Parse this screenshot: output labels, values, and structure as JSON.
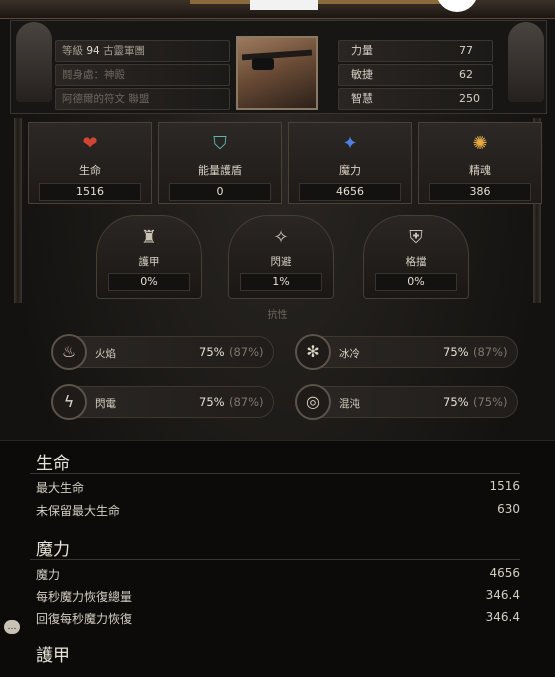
{
  "header": {
    "level_label": "等級",
    "level_value": "94",
    "class_name": "古靈軍團",
    "row2": "鬪身處：神殿",
    "row3": "阿德爾的符文 聯盟"
  },
  "attributes": [
    {
      "label": "力量",
      "value": "77"
    },
    {
      "label": "敏捷",
      "value": "62"
    },
    {
      "label": "智慧",
      "value": "250"
    }
  ],
  "main_stats": [
    {
      "label": "生命",
      "value": "1516",
      "icon": "heart-icon",
      "color": "#c0392b"
    },
    {
      "label": "能量護盾",
      "value": "0",
      "icon": "shield-icon",
      "color": "#4fa0a0"
    },
    {
      "label": "魔力",
      "value": "4656",
      "icon": "mana-icon",
      "color": "#3a6bd6"
    },
    {
      "label": "精魂",
      "value": "386",
      "icon": "spirit-icon",
      "color": "#e0a040"
    }
  ],
  "defenses": [
    {
      "label": "護甲",
      "value": "0%",
      "icon": "armour-icon"
    },
    {
      "label": "閃避",
      "value": "1%",
      "icon": "evasion-icon"
    },
    {
      "label": "格擋",
      "value": "0%",
      "icon": "block-icon"
    }
  ],
  "resist_title": "抗性",
  "resistances": [
    {
      "label": "火焰",
      "value": "75%",
      "cap": "(87%)",
      "icon": "fire-icon"
    },
    {
      "label": "冰冷",
      "value": "75%",
      "cap": "(87%)",
      "icon": "cold-icon"
    },
    {
      "label": "閃電",
      "value": "75%",
      "cap": "(87%)",
      "icon": "lightning-icon"
    },
    {
      "label": "混沌",
      "value": "75%",
      "cap": "(75%)",
      "icon": "chaos-icon"
    }
  ],
  "sections": {
    "life": {
      "title": "生命",
      "rows": [
        {
          "label": "最大生命",
          "value": "1516"
        },
        {
          "label": "未保留最大生命",
          "value": "630"
        }
      ]
    },
    "mana": {
      "title": "魔力",
      "rows": [
        {
          "label": "魔力",
          "value": "4656"
        },
        {
          "label": "每秒魔力恢復總量",
          "value": "346.4"
        },
        {
          "label": "回復每秒魔力恢復",
          "value": "346.4"
        }
      ]
    },
    "armour": {
      "title": "護甲"
    }
  }
}
